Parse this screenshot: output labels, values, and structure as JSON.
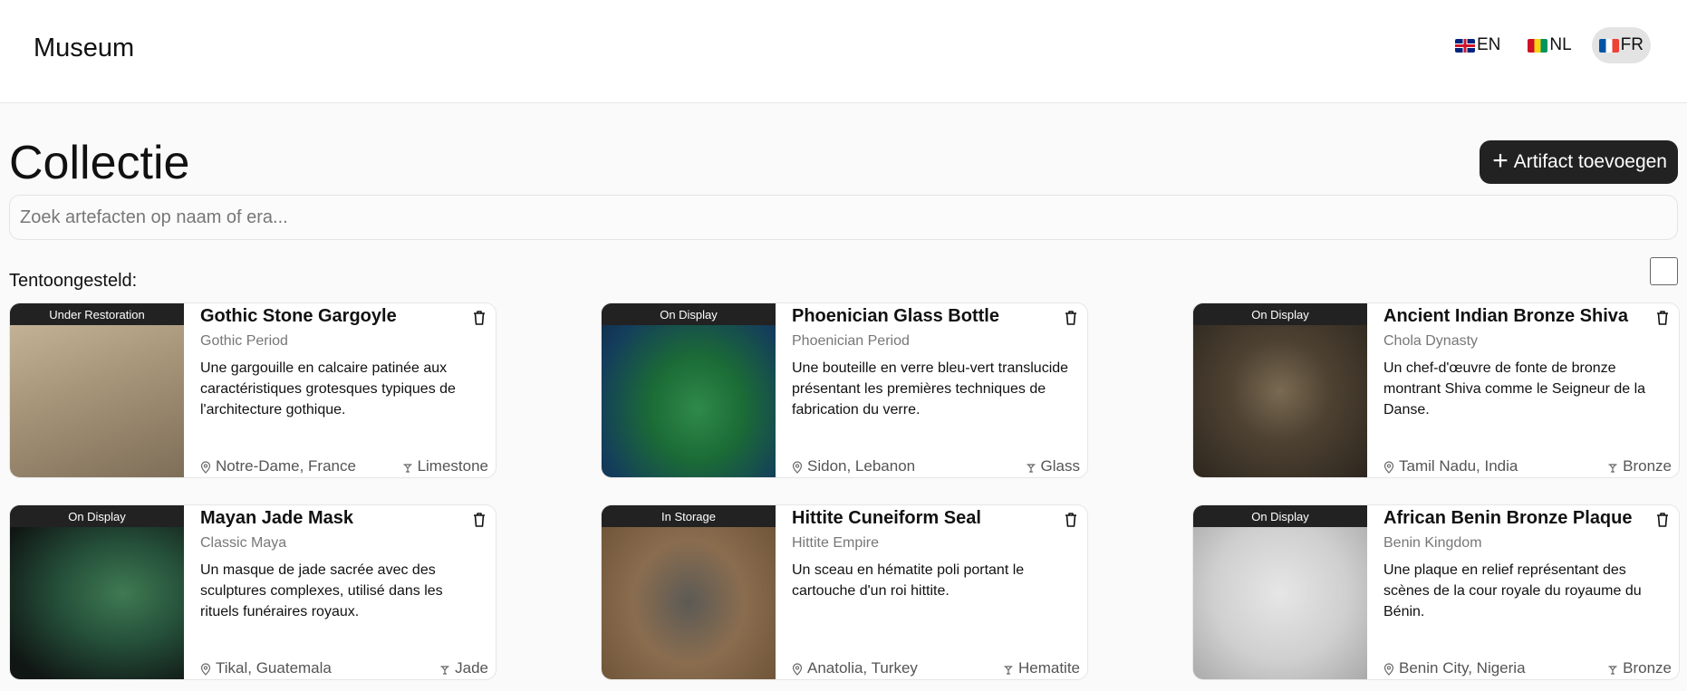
{
  "header": {
    "brand": "Museum",
    "languages": [
      {
        "code": "EN",
        "flag": "flag-uk-icon",
        "active": false
      },
      {
        "code": "NL",
        "flag": "flag-gn-icon",
        "active": false
      },
      {
        "code": "FR",
        "flag": "flag-fr-icon",
        "active": true
      }
    ]
  },
  "main": {
    "title": "Collectie",
    "add_button_label": "Artifact toevoegen",
    "search_placeholder": "Zoek artefacten op naam of era...",
    "filter_label": "Tentoongesteld:",
    "filter_checked": false
  },
  "artifacts": [
    {
      "status": "Under Restoration",
      "name": "Gothic Stone Gargoyle",
      "era": "Gothic Period",
      "description": "Une gargouille en calcaire patinée aux caractéristiques grotesques typiques de l'architecture gothique.",
      "location": "Notre-Dame, France",
      "material": "Limestone",
      "image": "gargoyle-image"
    },
    {
      "status": "On Display",
      "name": "Phoenician Glass Bottle",
      "era": "Phoenician Period",
      "description": "Une bouteille en verre bleu-vert translucide présentant les premières techniques de fabrication du verre.",
      "location": "Sidon, Lebanon",
      "material": "Glass",
      "image": "glass-bottle-image"
    },
    {
      "status": "On Display",
      "name": "Ancient Indian Bronze Shiva",
      "era": "Chola Dynasty",
      "description": "Un chef-d'œuvre de fonte de bronze montrant Shiva comme le Seigneur de la Danse.",
      "location": "Tamil Nadu, India",
      "material": "Bronze",
      "image": "shiva-statue-image"
    },
    {
      "status": "On Display",
      "name": "Mayan Jade Mask",
      "era": "Classic Maya",
      "description": "Un masque de jade sacrée avec des sculptures complexes, utilisé dans les rituels funéraires royaux.",
      "location": "Tikal, Guatemala",
      "material": "Jade",
      "image": "jade-mask-image"
    },
    {
      "status": "In Storage",
      "name": "Hittite Cuneiform Seal",
      "era": "Hittite Empire",
      "description": "Un sceau en hématite poli portant le cartouche d'un roi hittite.",
      "location": "Anatolia, Turkey",
      "material": "Hematite",
      "image": "cylinder-seal-image"
    },
    {
      "status": "On Display",
      "name": "African Benin Bronze Plaque",
      "era": "Benin Kingdom",
      "description": "Une plaque en relief représentant des scènes de la cour royale du royaume du Bénin.",
      "location": "Benin City, Nigeria",
      "material": "Bronze",
      "image": "bronze-plaque-image"
    }
  ]
}
